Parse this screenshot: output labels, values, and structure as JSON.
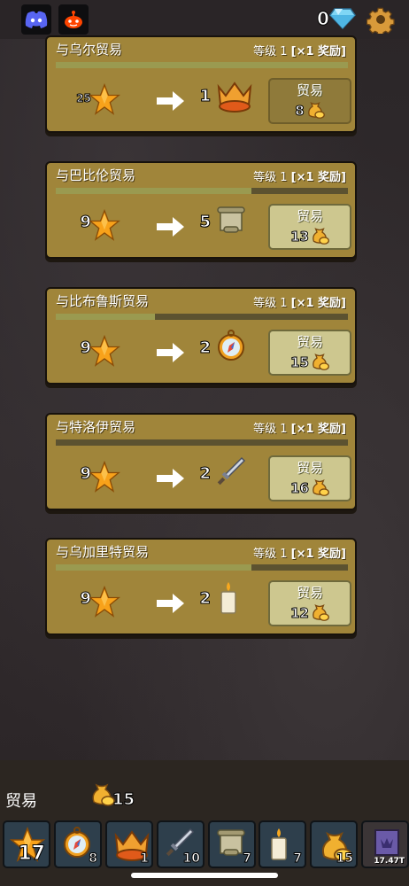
{
  "header": {
    "gem_count": "0",
    "icons": [
      "discord-icon",
      "reddit-icon",
      "diamond-icon",
      "gear-icon"
    ]
  },
  "trade_label": "贸易",
  "level_text": "等级 1",
  "reward_text": "[×1 奖励]",
  "cards": [
    {
      "title": "与乌尔贸易",
      "progress": 1.0,
      "cost": "25",
      "reward_count": "1",
      "reward_icon": "crown-icon",
      "price": "8",
      "enabled": false
    },
    {
      "title": "与巴比伦贸易",
      "progress": 0.67,
      "cost": "9",
      "reward_count": "5",
      "reward_icon": "scroll-icon",
      "price": "13",
      "enabled": true
    },
    {
      "title": "与比布鲁斯贸易",
      "progress": 0.34,
      "cost": "9",
      "reward_count": "2",
      "reward_icon": "compass-icon",
      "price": "15",
      "enabled": true
    },
    {
      "title": "与特洛伊贸易",
      "progress": 0.0,
      "cost": "9",
      "reward_count": "2",
      "reward_icon": "sword-icon",
      "price": "16",
      "enabled": true
    },
    {
      "title": "与乌加里特贸易",
      "progress": 0.67,
      "cost": "9",
      "reward_count": "2",
      "reward_icon": "candle-icon",
      "price": "12",
      "enabled": true
    }
  ],
  "bottom": {
    "label": "贸易",
    "coins": "15",
    "inventory": [
      {
        "name": "star",
        "count": "17"
      },
      {
        "name": "compass",
        "count": "8"
      },
      {
        "name": "crown",
        "count": "1"
      },
      {
        "name": "sword",
        "count": "10"
      },
      {
        "name": "scroll",
        "count": "7"
      },
      {
        "name": "candle",
        "count": "7"
      },
      {
        "name": "coin-bag",
        "count": "15"
      },
      {
        "name": "banner",
        "count": "17.47T"
      }
    ]
  }
}
